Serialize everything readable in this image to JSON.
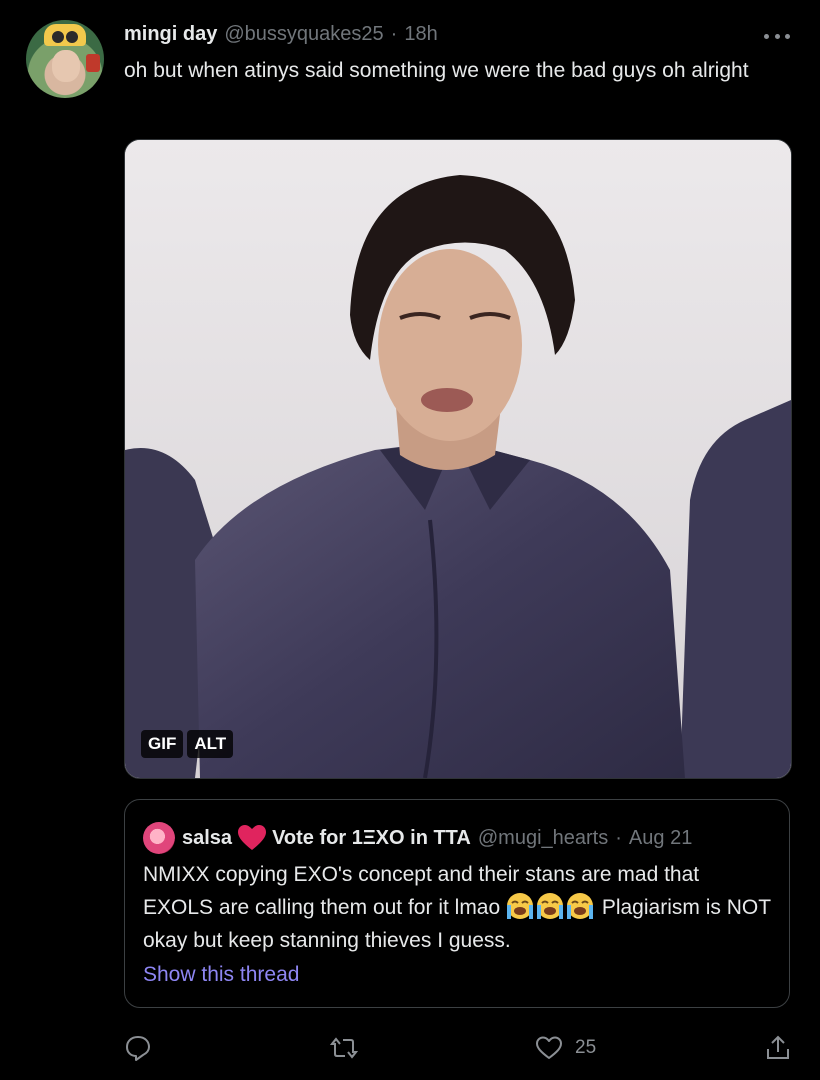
{
  "tweet": {
    "display_name": "mingi day",
    "handle": "@bussyquakes25",
    "separator": "·",
    "time": "18h",
    "text": "oh but when atinys said something we were the bad guys oh alright"
  },
  "media": {
    "badges": [
      "GIF",
      "ALT"
    ]
  },
  "quote": {
    "name": "salsa",
    "name_suffix": "Vote for 1ΞXO in TTA",
    "handle": "@mugi_hearts",
    "separator": "·",
    "date": "Aug 21",
    "text_before_emoji": "NMIXX copying EXO's concept and their stans are mad that EXOLS are calling them out for it lmao ",
    "emoji": [
      "loudly-crying-face",
      "loudly-crying-face",
      "loudly-crying-face"
    ],
    "text_after_emoji": " Plagiarism is NOT okay but keep stanning thieves I guess.",
    "show_thread": "Show this thread"
  },
  "actions": {
    "reply_count": "",
    "retweet_count": "",
    "like_count": "25"
  },
  "colors": {
    "background": "#000000",
    "text": "#e7e9ea",
    "muted": "#71767b",
    "link": "#8e86f3",
    "heart_emoji": "#e0245e"
  }
}
